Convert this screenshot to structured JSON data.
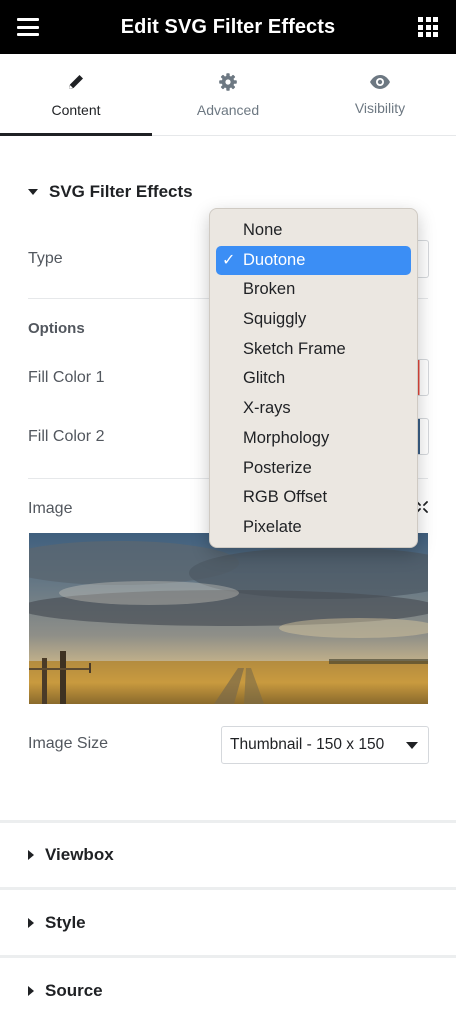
{
  "header": {
    "title": "Edit SVG Filter Effects",
    "menu_icon": "hamburger-icon",
    "apps_icon": "grid-icon"
  },
  "tabs": [
    {
      "label": "Content",
      "icon": "pencil-icon",
      "active": true
    },
    {
      "label": "Advanced",
      "icon": "gear-icon",
      "active": false
    },
    {
      "label": "Visibility",
      "icon": "eye-icon",
      "active": false
    }
  ],
  "section": {
    "title": "SVG Filter Effects",
    "type_label": "Type",
    "options_heading": "Options",
    "fill_color_1_label": "Fill Color 1",
    "fill_color_2_label": "Fill Color 2",
    "fill_color_1": "#e0473c",
    "fill_color_2": "#3a5f86",
    "image_label": "Image",
    "image_size_label": "Image Size",
    "image_size_value": "Thumbnail - 150 x 150"
  },
  "type_dropdown": {
    "selected": "Duotone",
    "options": [
      "None",
      "Duotone",
      "Broken",
      "Squiggly",
      "Sketch Frame",
      "Glitch",
      "X-rays",
      "Morphology",
      "Posterize",
      "RGB Offset",
      "Pixelate"
    ]
  },
  "collapsed_sections": [
    "Viewbox",
    "Style",
    "Source"
  ],
  "colors": {
    "topbar": "#000000",
    "selection": "#3b8ef5",
    "accent": "#1f2124"
  }
}
